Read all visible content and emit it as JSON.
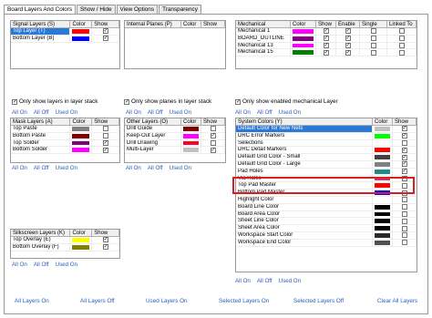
{
  "tabs": [
    "Board Layers And Colors",
    "Show / Hide",
    "View Options",
    "Transparency"
  ],
  "signal": {
    "headers": [
      "Signal Layers (S)",
      "Color",
      "Show"
    ],
    "rows": [
      {
        "name": "Top Layer (T)",
        "color": "#ff0000",
        "show": "✓",
        "selected": true
      },
      {
        "name": "Bottom Layer (B)",
        "color": "#0000ff",
        "show": "✓"
      }
    ]
  },
  "internal": {
    "headers": [
      "Internal Planes (P)",
      "Color",
      "Show"
    ]
  },
  "mech": {
    "headers": [
      "Mechanical",
      "Color",
      "Show",
      "Enable",
      "Single",
      "Linked To"
    ],
    "rows": [
      {
        "name": "Mechanical 1",
        "color": "#ff00ff",
        "show": "✓",
        "enable": "✓",
        "single": "",
        "linked": ""
      },
      {
        "name": "BOARD_OUTLINE",
        "color": "#800080",
        "show": "✓",
        "enable": "✓",
        "single": "",
        "linked": ""
      },
      {
        "name": "Mechanical 13",
        "color": "#ff00ff",
        "show": "✓",
        "enable": "✓",
        "single": "",
        "linked": ""
      },
      {
        "name": "Mechanical 15",
        "color": "#008000",
        "show": "✓",
        "enable": "✓",
        "single": "",
        "linked": ""
      }
    ]
  },
  "opts": {
    "layers_stack": "Only show layers in layer stack",
    "planes_stack": "Only show planes in layer stack",
    "mech_enabled": "Only show enabled mechanical Layer"
  },
  "links3": [
    "All On",
    "All Off",
    "Used On"
  ],
  "mask": {
    "headers": [
      "Mask Layers (A)",
      "Color",
      "Show"
    ],
    "rows": [
      {
        "name": "Top Paste",
        "color": "#808080",
        "show": ""
      },
      {
        "name": "Bottom Paste",
        "color": "#800000",
        "show": ""
      },
      {
        "name": "Top Solder",
        "color": "#800080",
        "show": "✓"
      },
      {
        "name": "Bottom Solder",
        "color": "#ff00ff",
        "show": "✓"
      }
    ]
  },
  "other": {
    "headers": [
      "Other Layers (O)",
      "Color",
      "Show"
    ],
    "rows": [
      {
        "name": "Drill Guide",
        "color": "#800000",
        "show": ""
      },
      {
        "name": "Keep-Out Layer",
        "color": "#ff00ff",
        "show": "✓"
      },
      {
        "name": "Drill Drawing",
        "color": "#ff002a",
        "show": ""
      },
      {
        "name": "Multi-Layer",
        "color": "#c0c0c0",
        "show": "✓"
      }
    ]
  },
  "silk": {
    "headers": [
      "Silkscreen Layers (K)",
      "Color",
      "Show"
    ],
    "rows": [
      {
        "name": "Top Overlay (E)",
        "color": "#ffff00",
        "show": "✓"
      },
      {
        "name": "Bottom Overlay (F)",
        "color": "#808000",
        "show": "✓"
      }
    ]
  },
  "system": {
    "headers": [
      "System Colors (Y)",
      "Color",
      "Show"
    ],
    "rows": [
      {
        "name": "Default Color for New Nets",
        "color": "#c0c0c0",
        "show": "✓",
        "selected": true
      },
      {
        "name": "DRC Error Markers",
        "color": "#00ff00",
        "show": "✓"
      },
      {
        "name": "Selections",
        "color": "#ffffff",
        "show": ""
      },
      {
        "name": "DRC Detail Markers",
        "color": "#ff0000",
        "show": "✓"
      },
      {
        "name": "Default Grid Color - Small",
        "color": "#404040",
        "show": "✓"
      },
      {
        "name": "Default Grid Color - Large",
        "color": "#808080",
        "show": "✓"
      },
      {
        "name": "Pad Holes",
        "color": "#1f8a8a",
        "show": "✓"
      },
      {
        "name": "Via Holes",
        "color": "#cc3366",
        "show": "✓"
      },
      {
        "name": "Top Pad Master",
        "color": "#ff0000",
        "show": ""
      },
      {
        "name": "Bottom Pad Master",
        "color": "#0000ff",
        "show": ""
      },
      {
        "name": "Highlight Color",
        "color": "#ffffff",
        "show": ""
      },
      {
        "name": "Board Line Color",
        "color": "#000000",
        "show": ""
      },
      {
        "name": "Board Area Color",
        "color": "#000000",
        "show": ""
      },
      {
        "name": "Sheet Line Color",
        "color": "#000000",
        "show": ""
      },
      {
        "name": "Sheet Area Color",
        "color": "#000000",
        "show": ""
      },
      {
        "name": "Workspace Start Color",
        "color": "#2a2a2a",
        "show": ""
      },
      {
        "name": "Workspace End Color",
        "color": "#505050",
        "show": ""
      }
    ]
  },
  "footer": [
    "All Layers On",
    "All Layers Off",
    "Used Layers On",
    "Selected Layers On",
    "Selected Layers Off",
    "Clear All Layers"
  ]
}
